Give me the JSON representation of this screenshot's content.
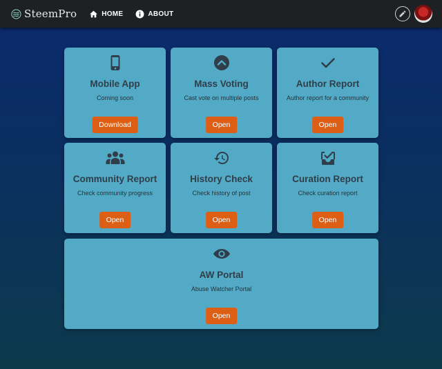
{
  "brand": {
    "name": "SteemPro",
    "icon": "steem-logo-icon"
  },
  "nav": [
    {
      "label": "HOME",
      "icon": "home-icon"
    },
    {
      "label": "ABOUT",
      "icon": "info-icon"
    }
  ],
  "header_actions": {
    "edit_icon": "pencil-icon",
    "avatar": "user-avatar"
  },
  "cards": [
    {
      "title": "Mobile App",
      "description": "Coming soon",
      "button": "Download",
      "icon": "mobile-phone-icon"
    },
    {
      "title": "Mass Voting",
      "description": "Cast vote on multiple posts",
      "button": "Open",
      "icon": "chevron-up-circle-icon"
    },
    {
      "title": "Author Report",
      "description": "Author report for a community",
      "button": "Open",
      "icon": "checkmark-icon"
    },
    {
      "title": "Community Report",
      "description": "Check community progress",
      "button": "Open",
      "icon": "people-group-icon"
    },
    {
      "title": "History Check",
      "description": "Check history of post",
      "button": "Open",
      "icon": "history-icon"
    },
    {
      "title": "Curation Report",
      "description": "Check curation report",
      "button": "Open",
      "icon": "inbox-check-icon"
    },
    {
      "title": "AW Portal",
      "description": "Abuse Watcher Portal",
      "button": "Open",
      "icon": "eye-icon"
    }
  ],
  "colors": {
    "card_bg": "#53aac6",
    "button_bg": "#dc5f15",
    "topbar_bg": "#1e2124",
    "icon_color": "#2f3e48"
  }
}
